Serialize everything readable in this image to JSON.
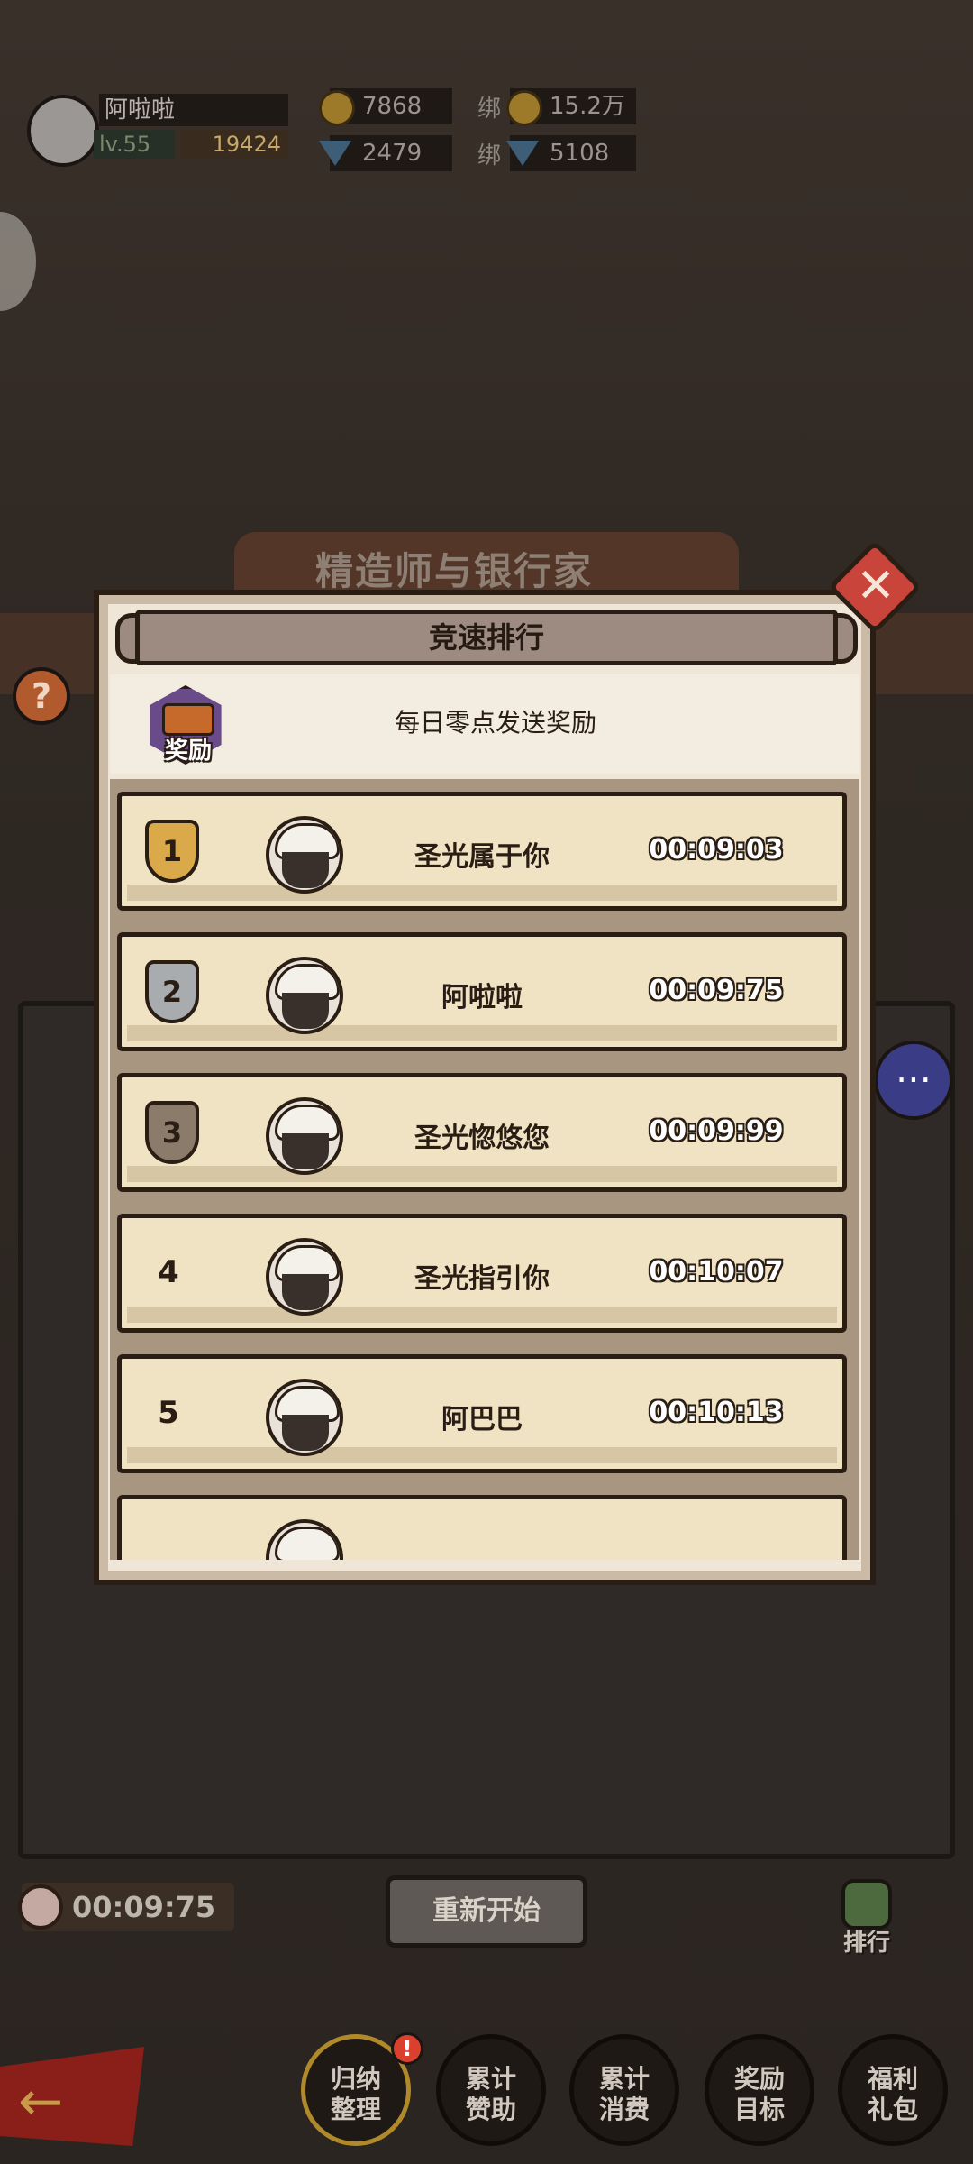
{
  "background": {
    "title": "精造师与银行家"
  },
  "hud": {
    "player_name": "阿啦啦",
    "level": "lv.55",
    "power": "19424",
    "gold": "7868",
    "gems": "2479",
    "bind_label": "绑",
    "bound_gold": "15.2万",
    "bound_gems": "5108"
  },
  "dialog": {
    "title": "竞速排行",
    "reward_icon_label": "奖励",
    "reward_text": "每日零点发送奖励",
    "rankings": [
      {
        "rank": "1",
        "name": "圣光属于你",
        "time": "00:09:03",
        "medal": "gold"
      },
      {
        "rank": "2",
        "name": "阿啦啦",
        "time": "00:09:75",
        "medal": "silver"
      },
      {
        "rank": "3",
        "name": "圣光惚悠您",
        "time": "00:09:99",
        "medal": "bronze"
      },
      {
        "rank": "4",
        "name": "圣光指引你",
        "time": "00:10:07",
        "medal": ""
      },
      {
        "rank": "5",
        "name": "阿巴巴",
        "time": "00:10:13",
        "medal": ""
      }
    ]
  },
  "bottom": {
    "timer": "00:09:75",
    "restart_label": "重新开始",
    "rank_label": "排行",
    "help_glyph": "?",
    "badge": "!",
    "nav": [
      {
        "label": "归纳\n整理"
      },
      {
        "label": "累计\n赞助"
      },
      {
        "label": "累计\n消费"
      },
      {
        "label": "奖励\n目标"
      },
      {
        "label": "福利\n礼包"
      }
    ]
  }
}
